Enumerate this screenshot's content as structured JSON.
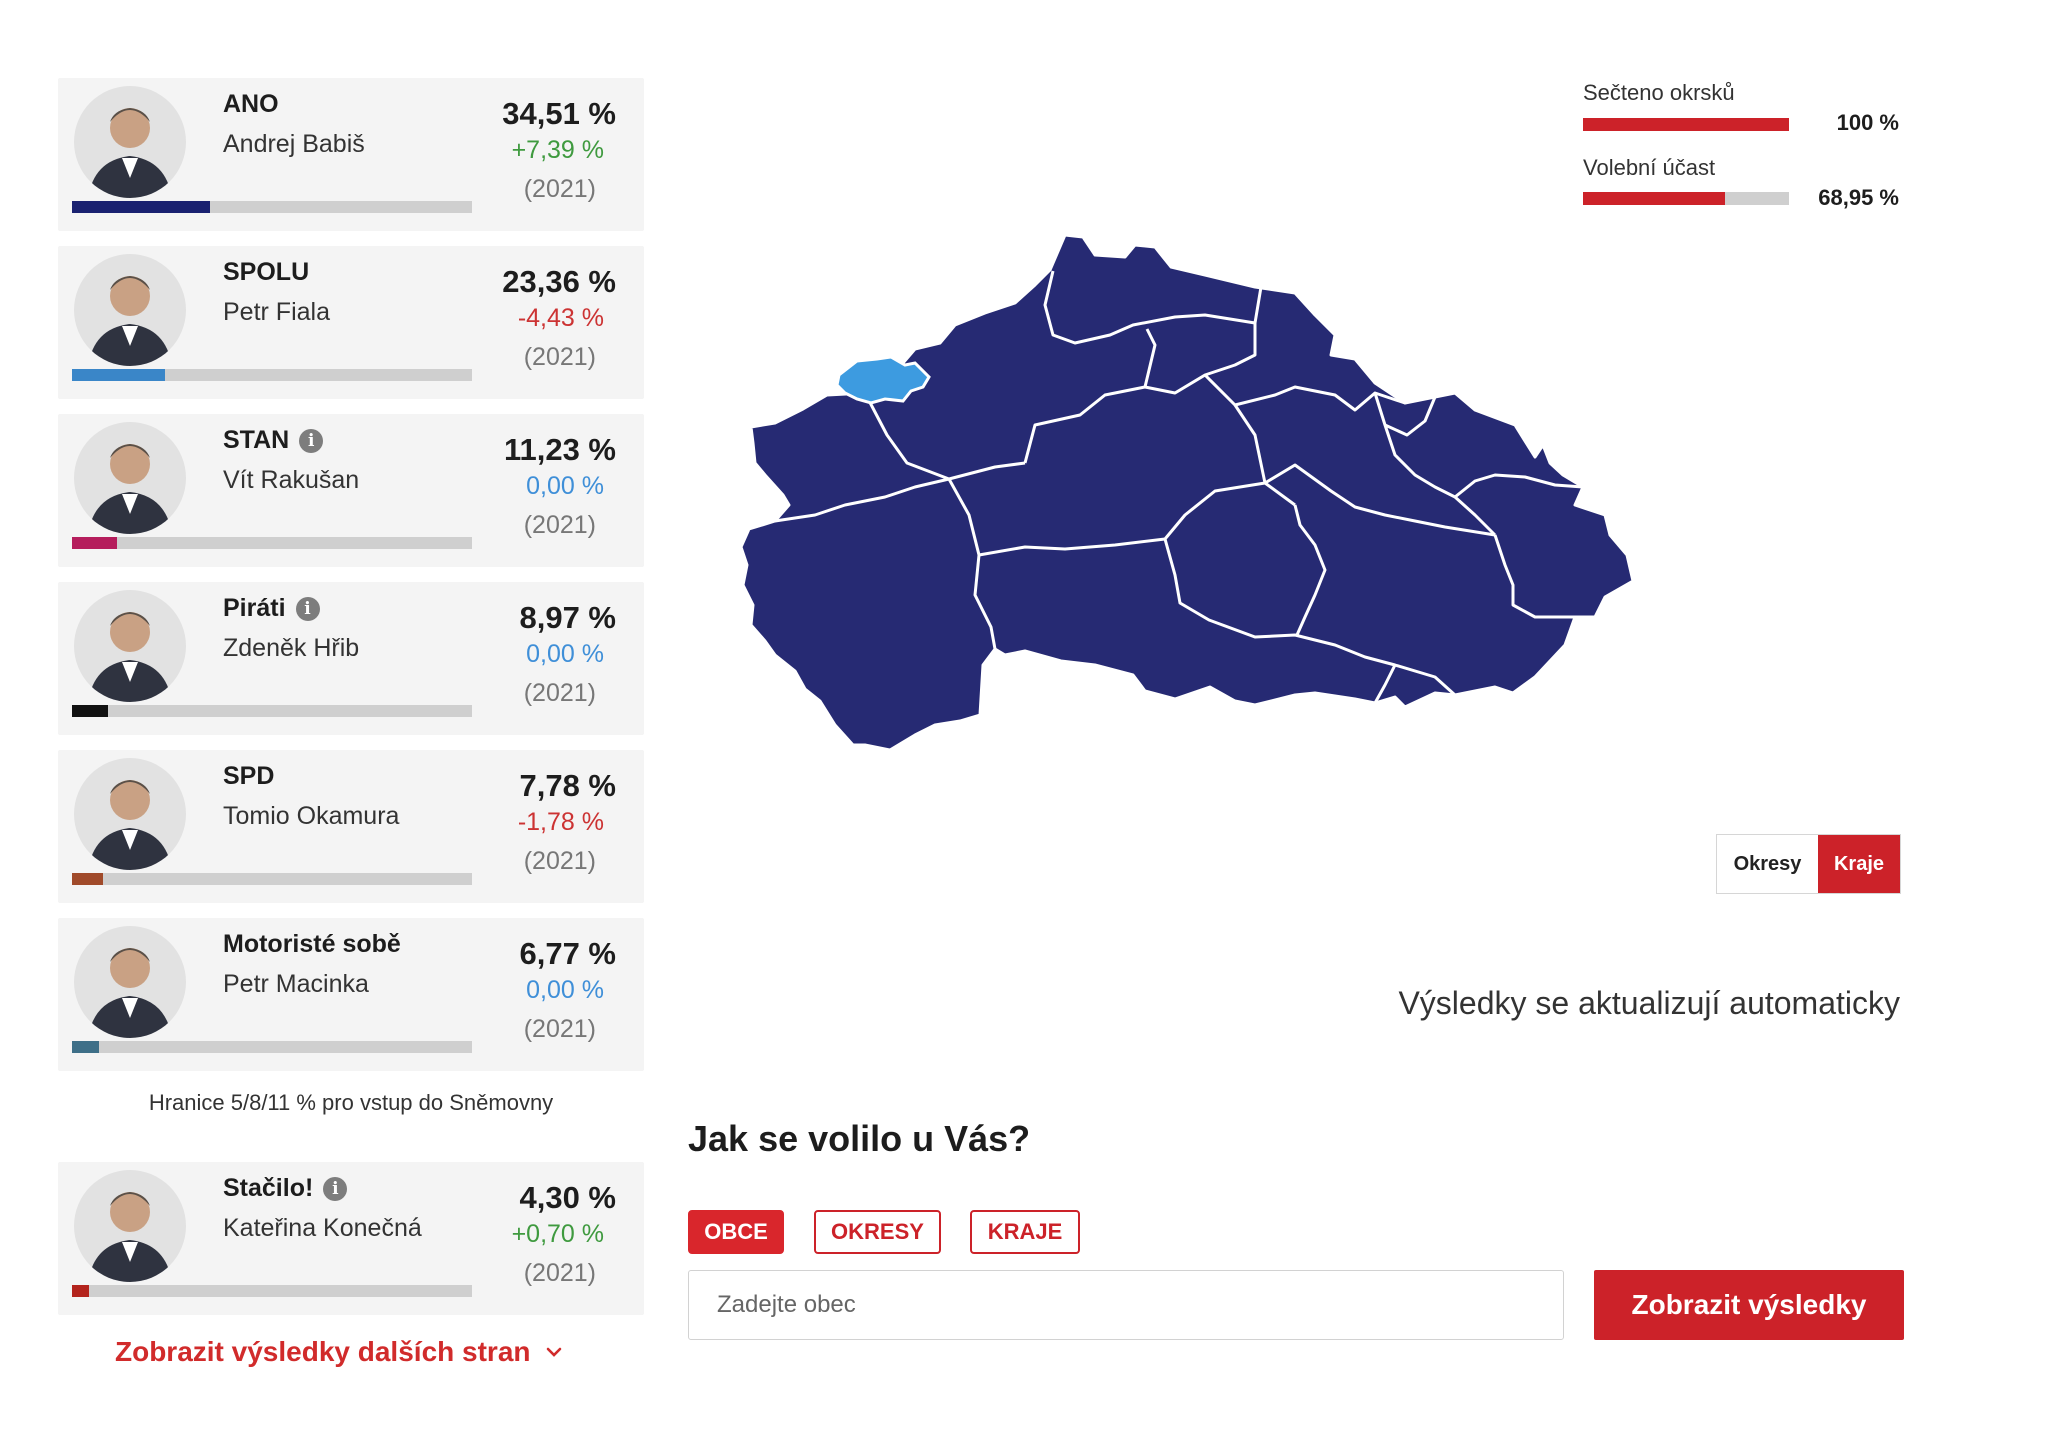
{
  "parties": [
    {
      "name": "ANO",
      "leader": "Andrej Babiš",
      "percent": "34,51 %",
      "diff": "+7,39 %",
      "diff_sign": "pos",
      "year": "(2021)",
      "info": false,
      "share": 0.3451,
      "color": "#1a2170"
    },
    {
      "name": "SPOLU",
      "leader": "Petr Fiala",
      "percent": "23,36 %",
      "diff": "-4,43 %",
      "diff_sign": "neg",
      "year": "(2021)",
      "info": false,
      "share": 0.2336,
      "color": "#3a86c8"
    },
    {
      "name": "STAN",
      "leader": "Vít Rakušan",
      "percent": "11,23 %",
      "diff": "0,00 %",
      "diff_sign": "zero",
      "year": "(2021)",
      "info": true,
      "share": 0.1123,
      "color": "#b51d5c"
    },
    {
      "name": "Piráti",
      "leader": "Zdeněk Hřib",
      "percent": "8,97 %",
      "diff": "0,00 %",
      "diff_sign": "zero",
      "year": "(2021)",
      "info": true,
      "share": 0.0897,
      "color": "#111111"
    },
    {
      "name": "SPD",
      "leader": "Tomio Okamura",
      "percent": "7,78 %",
      "diff": "-1,78 %",
      "diff_sign": "neg",
      "year": "(2021)",
      "info": false,
      "share": 0.0778,
      "color": "#a04a2a"
    },
    {
      "name": "Motoristé sobě",
      "leader": "Petr Macinka",
      "percent": "6,77 %",
      "diff": "0,00 %",
      "diff_sign": "zero",
      "year": "(2021)",
      "info": false,
      "share": 0.0677,
      "color": "#3e6f88"
    },
    {
      "name": "Stačilo!",
      "leader": "Kateřina Konečná",
      "percent": "4,30 %",
      "diff": "+0,70 %",
      "diff_sign": "pos",
      "year": "(2021)",
      "info": true,
      "share": 0.043,
      "color": "#b3241d"
    }
  ],
  "threshold_note": "Hranice 5/8/11 % pro vstup do Sněmovny",
  "more_results_link": "Zobrazit výsledky dalších stran",
  "stats": {
    "counted": {
      "label": "Sečteno okrsků",
      "value": "100 %",
      "fraction": 1.0
    },
    "turnout": {
      "label": "Volební účast",
      "value": "68,95 %",
      "fraction": 0.6895
    }
  },
  "map": {
    "region_color": "#262a73",
    "highlight_color": "#3d9be0",
    "toggle": {
      "districts": "Okresy",
      "regions": "Kraje",
      "active": "regions"
    }
  },
  "auto_update_note": "Výsledky se aktualizují automaticky",
  "local": {
    "heading": "Jak se volilo u Vás?",
    "filters": [
      {
        "label": "OBCE",
        "active": true
      },
      {
        "label": "OKRESY",
        "active": false
      },
      {
        "label": "KRAJE",
        "active": false
      }
    ],
    "search_placeholder": "Zadejte obec",
    "submit_label": "Zobrazit výsledky"
  }
}
